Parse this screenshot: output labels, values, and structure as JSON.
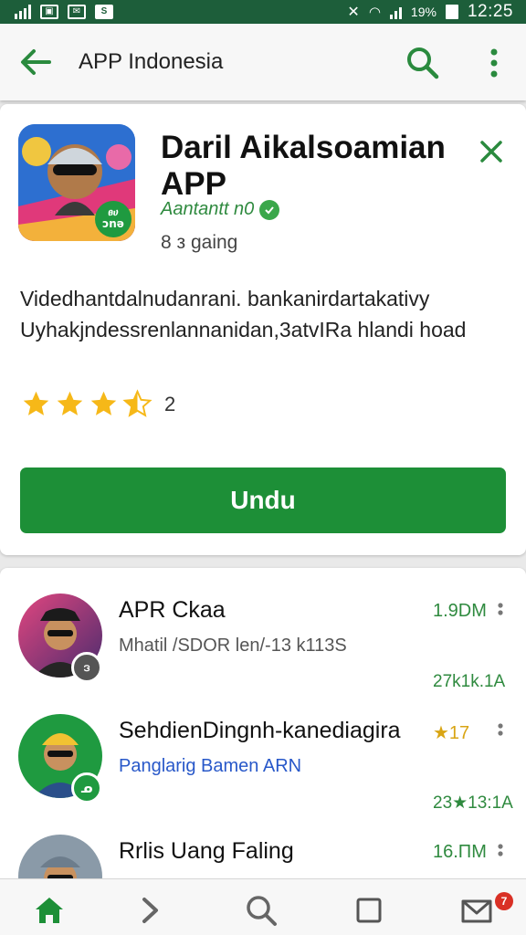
{
  "status_bar": {
    "time": "12:25",
    "battery": "19%"
  },
  "app_bar": {
    "title": "APP Indonesia",
    "icons": [
      "back-arrow-icon",
      "search-icon",
      "more-vert-icon"
    ]
  },
  "featured_app": {
    "title": "Daril Aikalsoamian APP",
    "developer": "Aantantt n0",
    "size": "8 з gaing",
    "description": "Videdhantdalnudanrani. bankanirdartakativy Uyhakjndessrenlannanidan,3atvIRa hlandi hoad",
    "rating_count": "2",
    "rating_value": 3.5,
    "install_label": "Undu",
    "accent_color": "#1d8f37"
  },
  "list": [
    {
      "title": "APR Ckaa",
      "subtitle": "Mhatil /SDOR len/-13 k113S",
      "right_top": "1.9DM",
      "right_bottom": "27k1k.1A",
      "badge": "ဒ"
    },
    {
      "title": "SehdienDingnh-kanediagira",
      "subtitle": "Panglarig Bamen ARN",
      "right_top": "★17",
      "right_bottom": "23★13:1A",
      "badge": "ᓄ"
    },
    {
      "title": "Rrlis Uang Faling",
      "subtitle": "",
      "right_top": "16.ΠM",
      "right_bottom": "",
      "badge": ""
    }
  ],
  "bottom_nav": {
    "items": [
      "home-icon",
      "forward-icon",
      "search-icon",
      "square-icon",
      "inbox-icon"
    ],
    "notification_count": "7"
  }
}
